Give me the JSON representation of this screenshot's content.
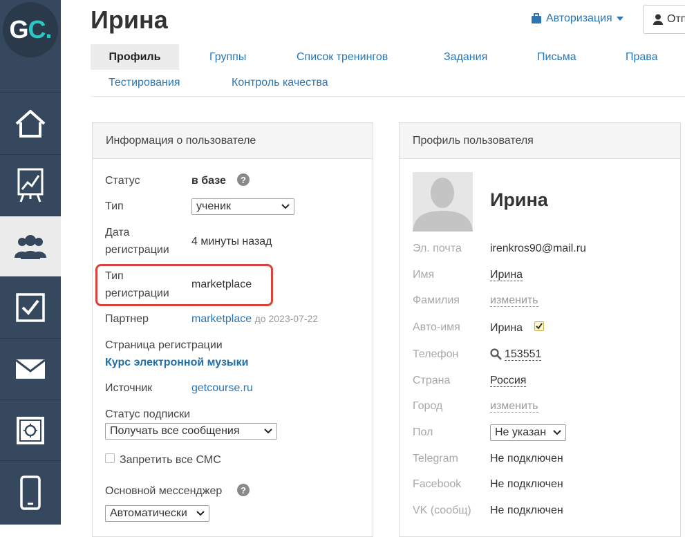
{
  "logo": {
    "text_g": "G",
    "text_c": "C",
    "dot": "."
  },
  "header": {
    "title": "Ирина",
    "auth_label": "Авторизация",
    "top_button_label": "Отп"
  },
  "tabs": [
    {
      "label": "Профиль",
      "active": true
    },
    {
      "label": "Группы"
    },
    {
      "label": "Список тренингов"
    },
    {
      "label": "Задания"
    },
    {
      "label": "Письма"
    },
    {
      "label": "Права"
    },
    {
      "label": "Тестирования"
    },
    {
      "label": "Контроль качества"
    }
  ],
  "user_info": {
    "heading": "Информация о пользователе",
    "status_label": "Статус",
    "status_value": "в базе",
    "type_label": "Тип",
    "type_value": "ученик",
    "reg_date_label_1": "Дата",
    "reg_date_label_2": "регистрации",
    "reg_date_value": "4 минуты назад",
    "reg_type_label_1": "Тип",
    "reg_type_label_2": "регистрации",
    "reg_type_value": "marketplace",
    "partner_label": "Партнер",
    "partner_value": "marketplace",
    "partner_until": "до 2023-07-22",
    "reg_page_label": "Страница регистрации",
    "reg_page_value": "Курс электронной музыки",
    "source_label": "Источник",
    "source_value": "getcourse.ru",
    "subscription_label": "Статус подписки",
    "subscription_value": "Получать все сообщения",
    "block_sms_label": "Запретить все СМС",
    "messenger_label": "Основной мессенджер",
    "messenger_value": "Автоматически"
  },
  "profile": {
    "heading": "Профиль пользователя",
    "name": "Ирина",
    "email_label": "Эл. почта",
    "email_value": "irenkros90@mail.ru",
    "first_name_label": "Имя",
    "first_name_value": "Ирина",
    "last_name_label": "Фамилия",
    "last_name_value": "изменить",
    "auto_name_label": "Авто-имя",
    "auto_name_value": "Ирина",
    "phone_label": "Телефон",
    "phone_value": "153551",
    "country_label": "Страна",
    "country_value": "Россия",
    "city_label": "Город",
    "city_value": "изменить",
    "gender_label": "Пол",
    "gender_value": "Не указан",
    "telegram_label": "Telegram",
    "telegram_value": "Не подключен",
    "facebook_label": "Facebook",
    "facebook_value": "Не подключен",
    "vk_label": "VK (сообщ)",
    "vk_value": "Не подключен"
  },
  "colors": {
    "sidebar": "#35485d",
    "accent_link": "#2a76b5",
    "highlight": "#d9413a",
    "logo_accent": "#2ec6c1"
  }
}
